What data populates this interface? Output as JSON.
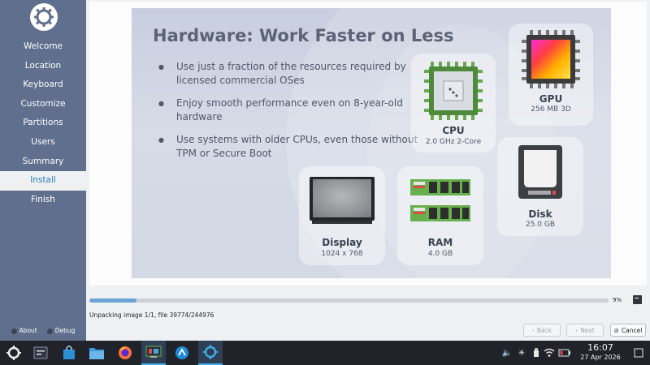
{
  "sidebar": {
    "steps": [
      {
        "label": "Welcome"
      },
      {
        "label": "Location"
      },
      {
        "label": "Keyboard"
      },
      {
        "label": "Customize"
      },
      {
        "label": "Partitions"
      },
      {
        "label": "Users"
      },
      {
        "label": "Summary"
      },
      {
        "label": "Install",
        "active": true
      },
      {
        "label": "Finish"
      }
    ],
    "about_label": "About",
    "debug_label": "Debug"
  },
  "slide": {
    "title": "Hardware: Work Faster on Less",
    "bullets": [
      "Use just a fraction of the resources required by licensed commercial OSes",
      "Enjoy smooth performance even on 8-year-old hardware",
      "Use systems with older CPUs, even those without TPM or Secure Boot"
    ],
    "cards": {
      "cpu": {
        "name": "CPU",
        "value": "2.0 GHz 2-Core"
      },
      "gpu": {
        "name": "GPU",
        "value": "256 MB 3D"
      },
      "disk": {
        "name": "Disk",
        "value": "25.0 GB"
      },
      "display": {
        "name": "Display",
        "value": "1024 x 768"
      },
      "ram": {
        "name": "RAM",
        "value": "4.0 GB"
      }
    }
  },
  "progress": {
    "percent": 9,
    "percent_label": "9%",
    "status": "Unpacking image 1/1, file 39774/244976"
  },
  "buttons": {
    "back": "Back",
    "next": "Next",
    "cancel": "Cancel"
  },
  "taskbar": {
    "apps": [
      "app-launcher",
      "system-monitor",
      "discover",
      "file-manager",
      "firefox",
      "media-app",
      "network-app",
      "installer"
    ],
    "clock_time": "16:07",
    "clock_date": "27 Apr 2026"
  },
  "colors": {
    "sidebar_bg": "#5f6f8d",
    "accent": "#3daee9",
    "taskbar_bg": "#20242a"
  }
}
